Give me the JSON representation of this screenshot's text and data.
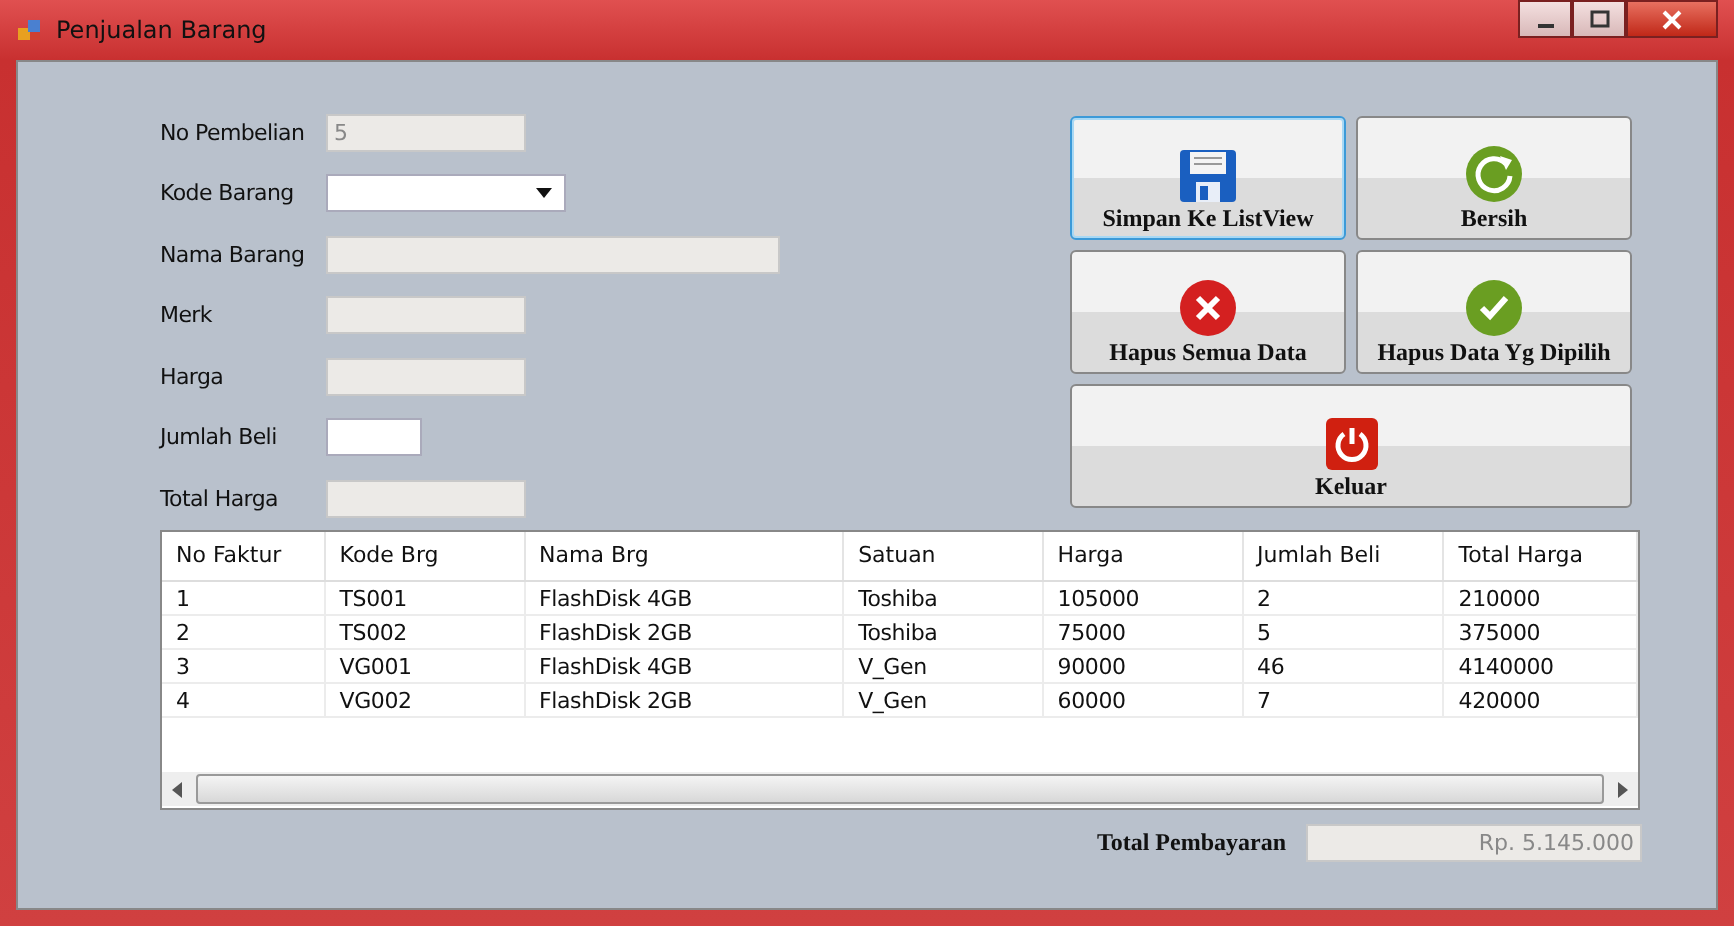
{
  "window": {
    "title": "Penjualan Barang"
  },
  "fields": [
    {
      "label": "No Pembelian",
      "kind": "text",
      "value": "5",
      "disabled": true
    },
    {
      "label": "Kode Barang",
      "kind": "combo",
      "disabled": false
    },
    {
      "label": "Nama Barang",
      "kind": "text",
      "disabled": true
    },
    {
      "label": "Merk",
      "kind": "text",
      "disabled": true
    },
    {
      "label": "Harga",
      "kind": "text",
      "disabled": true
    },
    {
      "label": "Jumlah Beli",
      "kind": "text",
      "disabled": false
    },
    {
      "label": "Total Harga",
      "kind": "text",
      "disabled": true
    }
  ],
  "buttons": [
    {
      "label": "Simpan Ke ListView",
      "selected": true
    },
    {
      "label": "Bersih",
      "selected": false
    },
    {
      "label": "Hapus Semua Data",
      "selected": false
    },
    {
      "label": "Hapus Data Yg Dipilih",
      "selected": false
    },
    {
      "label": "Keluar",
      "selected": false
    }
  ],
  "table": {
    "columns": [
      "No Faktur",
      "Kode Brg",
      "Nama Brg",
      "Satuan",
      "Harga",
      "Jumlah Beli",
      "Total Harga"
    ],
    "rows": [
      [
        "1",
        "TS001",
        "FlashDisk 4GB",
        "Toshiba",
        "105000",
        "2",
        "210000"
      ],
      [
        "2",
        "TS002",
        "FlashDisk 2GB",
        "Toshiba",
        "75000",
        "5",
        "375000"
      ],
      [
        "3",
        "VG001",
        "FlashDisk 4GB",
        "V_Gen",
        "90000",
        "46",
        "4140000"
      ],
      [
        "4",
        "VG002",
        "FlashDisk 2GB",
        "V_Gen",
        "60000",
        "7",
        "420000"
      ]
    ]
  },
  "total": {
    "label": "Total Pembayaran",
    "value": "Rp. 5.145.000",
    "disabled": true
  }
}
